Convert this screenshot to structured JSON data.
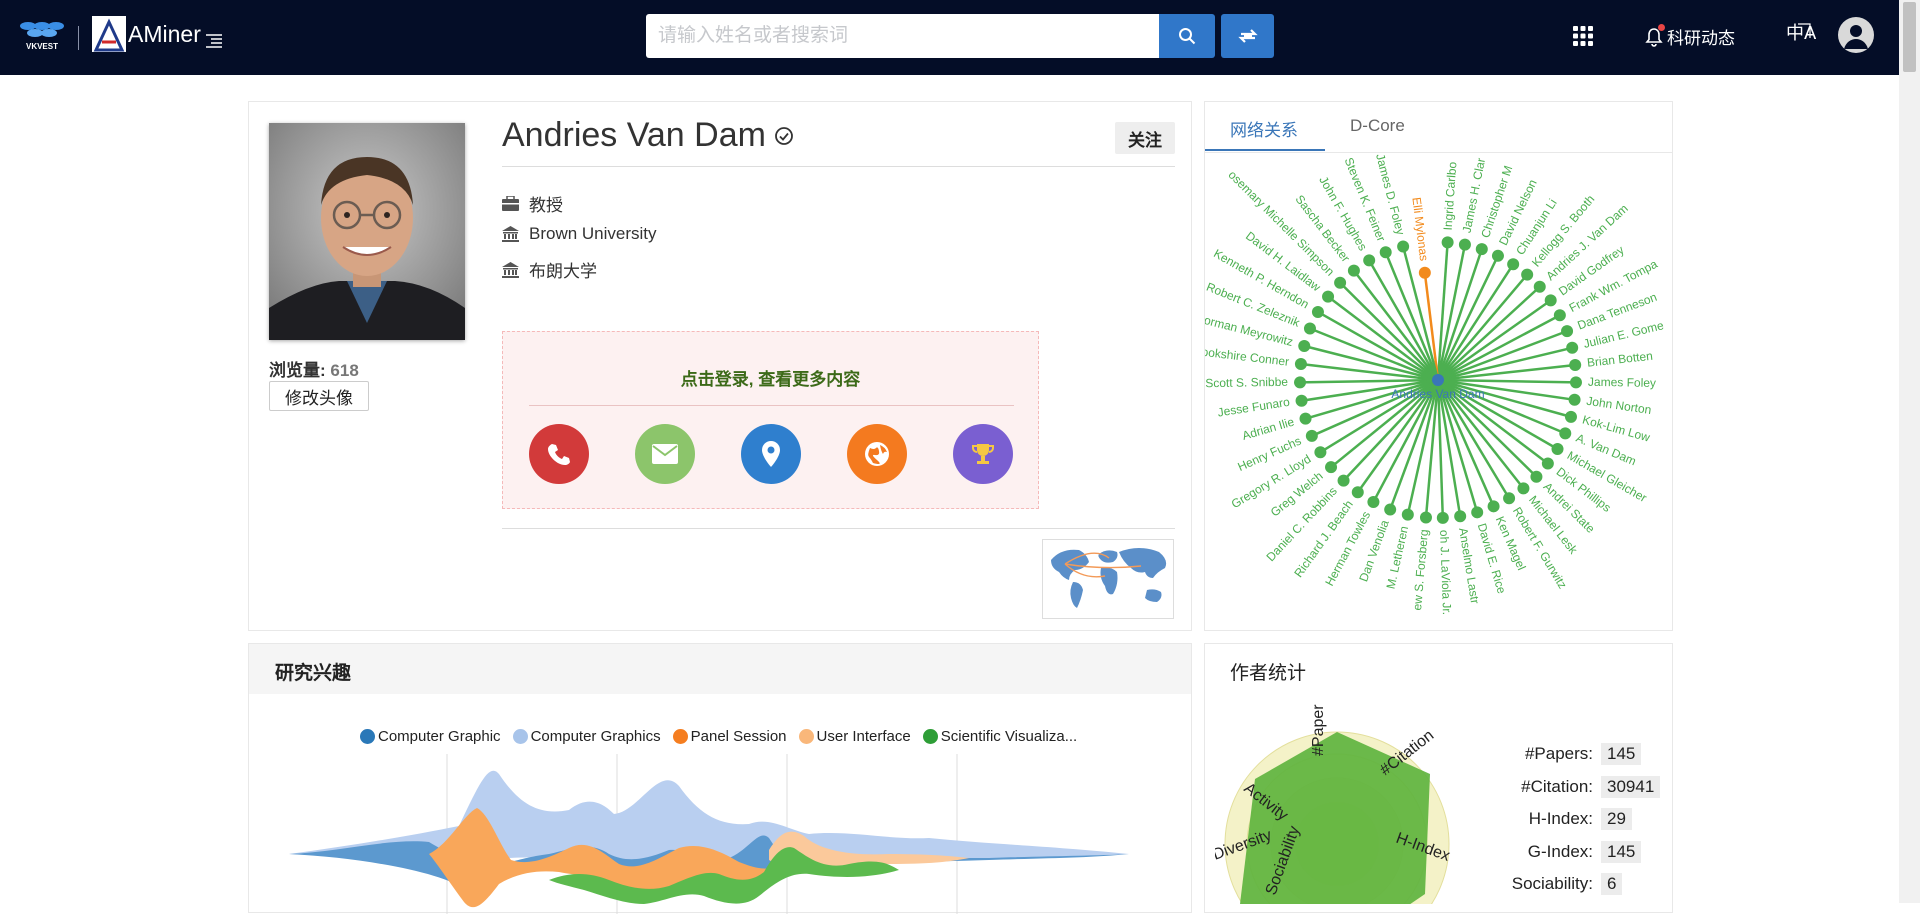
{
  "header": {
    "org_logo": "VKVEST",
    "brand": "AMiner",
    "search": {
      "placeholder": "请输入姓名或者搜索词",
      "value": ""
    },
    "notification_label": "科研动态",
    "language_icon": "中A"
  },
  "profile": {
    "name": "Andries Van Dam",
    "follow_label": "关注",
    "views_label": "浏览量:",
    "views_value": "618",
    "change_avatar_label": "修改头像",
    "position": "教授",
    "affiliation_en": "Brown University",
    "affiliation_zh": "布朗大学",
    "login_prompt": "点击登录, 查看更多内容",
    "contact_icons": [
      "phone-icon",
      "email-icon",
      "location-icon",
      "homepage-icon",
      "award-icon"
    ]
  },
  "network": {
    "tabs": [
      "网络关系",
      "D-Core"
    ],
    "active_tab": 0,
    "center_name": "Andries Van Dam",
    "highlighted_name": "Elli Mylonas",
    "colors": {
      "node": "#4caf50",
      "highlight": "#f28a1c",
      "center": "#3a76b8",
      "label": "#4caf50"
    },
    "names_right": [
      "Ingrid Carlbo",
      "James H. Clar",
      "Christopher M",
      "David Nelson",
      "Chuanjun Li",
      "Kellogg S. Booth",
      "Andries J. Van Dam",
      "David Godfrey",
      "Frank Wm. Tompa",
      "Dana Tenneson",
      "Julian E. Gome",
      "Brian Botten",
      "James Foley",
      "John Norton",
      "Kok-Lim Low",
      "A. Van Dam",
      "Michael Gleicher",
      "Dick Phillips",
      "Andrei State",
      "Michael Lesk",
      "Robert F. Gurwitz",
      "Ken Magel",
      "David E. Rice",
      "Anselmo Lastr",
      "oh J. LaViola Jr."
    ],
    "names_left": [
      "Elli Mylonas",
      "James D. Foley",
      "Steven K. Feiner",
      "John F. Hughes",
      "Sascha Becker",
      "osemary Michelle Simpson",
      "David H. Laidlaw",
      "Kenneth P. Herndon",
      "Robert C. Zeleznik",
      "lorman Meyrowitz",
      "rookshire Conner",
      "Scott S. Snibbe",
      "Jesse Funaro",
      "Adrian Ilie",
      "Henry Fuchs",
      "Gregory R. Lloyd",
      "Greg Welch",
      "Daniel C. Robbins",
      "Richard J. Beach",
      "Herman Towles",
      "Dan Venolia",
      "M. Letheren",
      "ew S. Forsberg"
    ]
  },
  "interests": {
    "title": "研究兴趣",
    "legend": [
      {
        "label": "Computer Graphic",
        "color": "#2a78b8"
      },
      {
        "label": "Computer Graphics",
        "color": "#a8c4ea"
      },
      {
        "label": "Panel Session",
        "color": "#f57e20"
      },
      {
        "label": "User Interface",
        "color": "#f9b77a"
      },
      {
        "label": "Scientific Visualiza...",
        "color": "#2e9e37"
      }
    ]
  },
  "stats": {
    "title": "作者统计",
    "rows": [
      {
        "label": "#Papers:",
        "value": "145"
      },
      {
        "label": "#Citation:",
        "value": "30941"
      },
      {
        "label": "H-Index:",
        "value": "29"
      },
      {
        "label": "G-Index:",
        "value": "145"
      },
      {
        "label": "Sociability:",
        "value": "6"
      }
    ],
    "radar_labels": [
      "#Papers",
      "#Citation",
      "H-Index",
      "Diversity",
      "Activity",
      "Sociability"
    ]
  }
}
